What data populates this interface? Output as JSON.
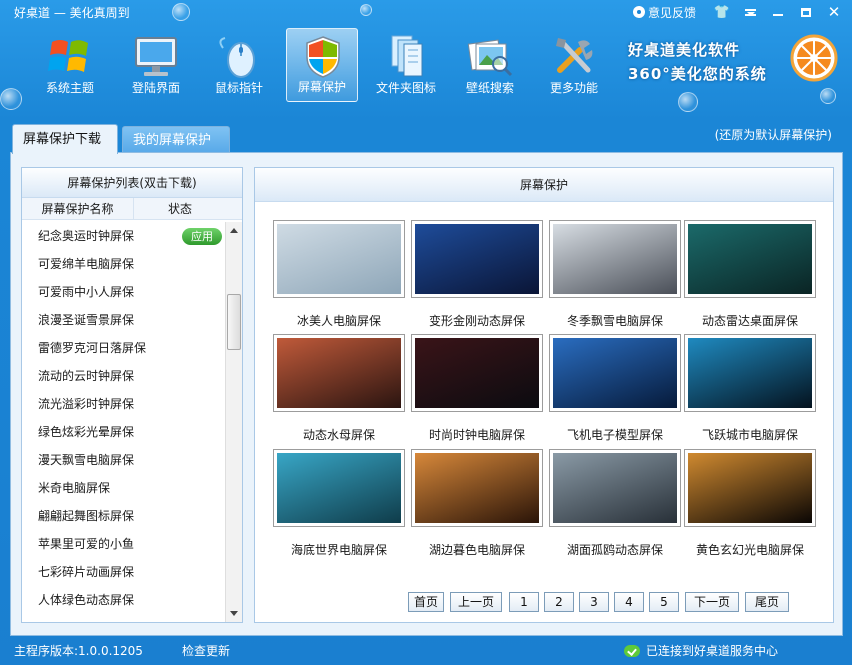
{
  "window": {
    "title": "好桌道 — 美化真周到"
  },
  "title_controls": {
    "feedback_label": "意见反馈"
  },
  "toolbar": {
    "items": [
      {
        "label": "系统主题",
        "icon": "windows-logo-icon"
      },
      {
        "label": "登陆界面",
        "icon": "monitor-icon"
      },
      {
        "label": "鼠标指针",
        "icon": "mouse-icon"
      },
      {
        "label": "屏幕保护",
        "icon": "shield-icon"
      },
      {
        "label": "文件夹图标",
        "icon": "folder-icon"
      },
      {
        "label": "壁纸搜索",
        "icon": "picture-search-icon"
      },
      {
        "label": "更多功能",
        "icon": "tools-icon"
      }
    ],
    "active_index": 3,
    "brand_line1": "好桌道美化软件",
    "brand_line2": "360°美化您的系统"
  },
  "tabs": [
    {
      "label": "屏幕保护下载",
      "active": true
    },
    {
      "label": "我的屏幕保护",
      "active": false
    }
  ],
  "restore_link": "(还原为默认屏幕保护)",
  "list": {
    "header": "屏幕保护列表(双击下载)",
    "col_name": "屏幕保护名称",
    "col_status": "状态",
    "apply_label": "应用",
    "items": [
      "纪念奥运时钟屏保",
      "可爱绵羊电脑屏保",
      "可爱雨中小人屏保",
      "浪漫圣诞雪景屏保",
      "雷德罗克河日落屏保",
      "流动的云时钟屏保",
      "流光溢彩时钟屏保",
      "绿色炫彩光晕屏保",
      "漫天飘雪电脑屏保",
      "米奇电脑屏保",
      "翩翩起舞图标屏保",
      "苹果里可爱的小鱼",
      "七彩碎片动画屏保",
      "人体绿色动态屏保"
    ]
  },
  "gallery": {
    "header": "屏幕保护",
    "items": [
      {
        "caption": "冰美人电脑屏保",
        "colors": [
          "#cfdbe4",
          "#8ea6b8"
        ]
      },
      {
        "caption": "变形金刚动态屏保",
        "colors": [
          "#1e4c9a",
          "#0a1536"
        ]
      },
      {
        "caption": "冬季飘雪电脑屏保",
        "colors": [
          "#d7dde3",
          "#4a4f58"
        ]
      },
      {
        "caption": "动态雷达桌面屏保",
        "colors": [
          "#1b6a6a",
          "#0a2424"
        ]
      },
      {
        "caption": "动态水母屏保",
        "colors": [
          "#c05a3a",
          "#2a1410"
        ]
      },
      {
        "caption": "时尚时钟电脑屏保",
        "colors": [
          "#3a1418",
          "#0b0b10"
        ]
      },
      {
        "caption": "飞机电子模型屏保",
        "colors": [
          "#2a6dc0",
          "#061a3a"
        ]
      },
      {
        "caption": "飞跃城市电脑屏保",
        "colors": [
          "#1f8ac0",
          "#04121e"
        ]
      },
      {
        "caption": "海底世界电脑屏保",
        "colors": [
          "#38a6c6",
          "#0f3c4a"
        ]
      },
      {
        "caption": "湖边暮色电脑屏保",
        "colors": [
          "#d7883a",
          "#2a1408"
        ]
      },
      {
        "caption": "湖面孤鸥动态屏保",
        "colors": [
          "#8a9aa6",
          "#283038"
        ]
      },
      {
        "caption": "黄色玄幻光电脑屏保",
        "colors": [
          "#d08a30",
          "#0a0604"
        ]
      }
    ]
  },
  "pager": {
    "first": "首页",
    "prev": "上一页",
    "pages": [
      "1",
      "2",
      "3",
      "4",
      "5"
    ],
    "next": "下一页",
    "last": "尾页"
  },
  "status": {
    "version": "主程序版本:1.0.0.1205",
    "check_update": "检查更新",
    "connection": "已连接到好桌道服务中心"
  }
}
